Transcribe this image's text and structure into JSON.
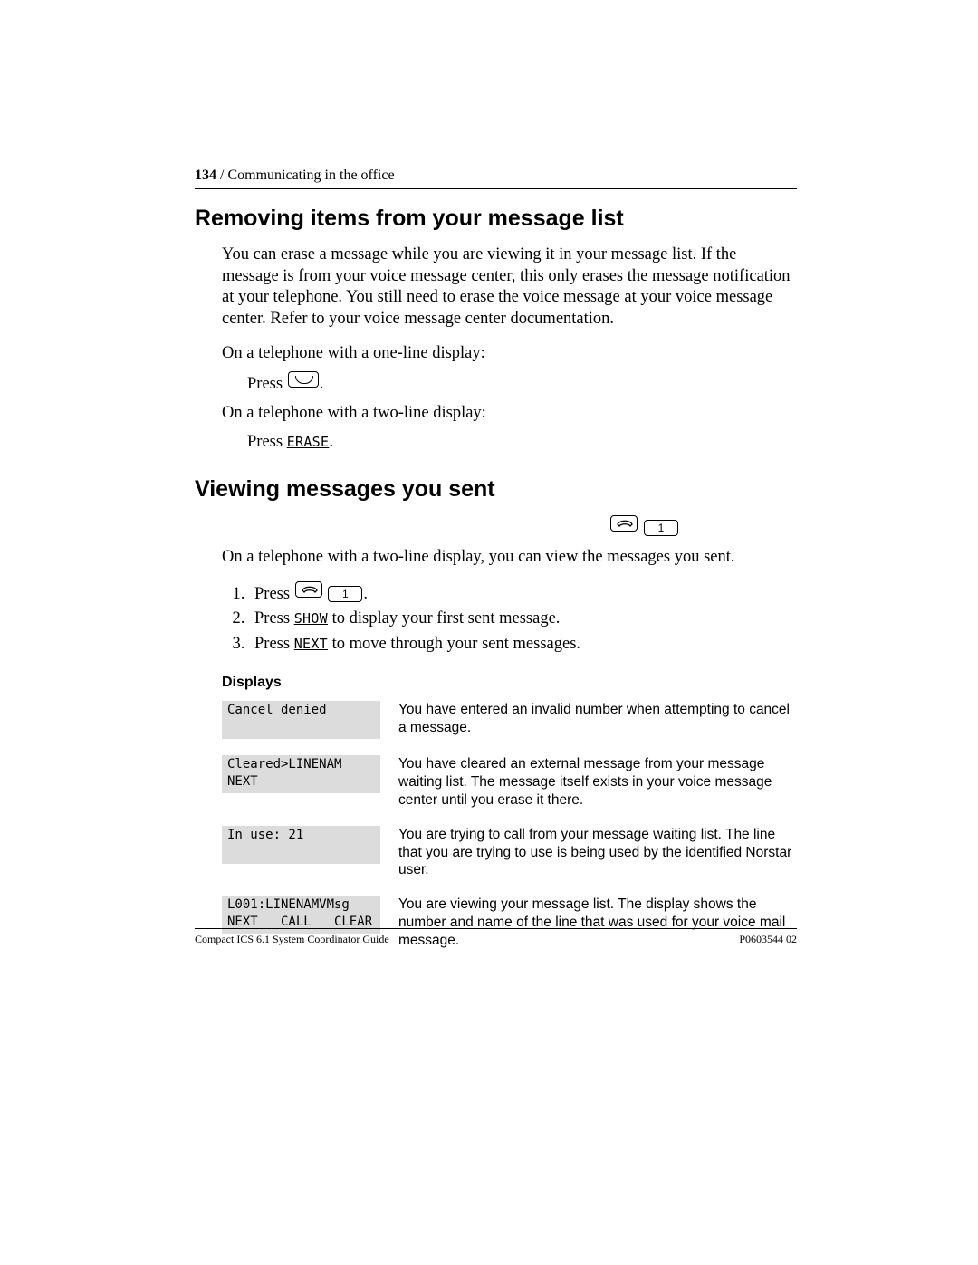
{
  "header": {
    "page_number": "134",
    "sep": " / ",
    "section": "Communicating in the office"
  },
  "section1": {
    "title": "Removing items from your message list",
    "para1": "You can erase a message while you are viewing it in your message list. If the message is from your voice message center, this only erases the message notification at your telephone. You still need to erase the voice message at your voice message center. Refer to your voice message center documentation.",
    "oneline_intro": "On a telephone with a one-line display:",
    "press_word": "Press ",
    "period": ".",
    "twoline_intro": "On a telephone with a two-line display:",
    "erase_label": "ERASE"
  },
  "section2": {
    "title": "Viewing messages you sent",
    "key_feature_icon": "feature",
    "key_digit": "1",
    "intro": "On a telephone with a two-line display, you can view the messages you sent.",
    "step1_a": "Press ",
    "step1_b": ".",
    "step2_a": "Press ",
    "step2_label": "SHOW",
    "step2_b": " to display your first sent message.",
    "step3_a": "Press ",
    "step3_label": "NEXT",
    "step3_b": " to move through your sent messages."
  },
  "displays": {
    "heading": "Displays",
    "rows": [
      {
        "line1": "Cancel denied",
        "line2": "",
        "desc": "You have entered an invalid number when attempting to cancel a message."
      },
      {
        "line1": "Cleared>LINENAM",
        "line2": "NEXT",
        "desc": "You have cleared an external message from your message waiting list. The message itself exists in your voice message center until you erase it there."
      },
      {
        "line1": "In use: 21",
        "line2": "",
        "desc": "You are trying to call from your message waiting list. The line that you are trying to use is being used by the identified Norstar user."
      },
      {
        "line1": "L001:LINENAMVMsg",
        "line2": "NEXT   CALL   CLEAR",
        "desc": "You are viewing your message list. The display shows the number and name of the line that was used for your voice mail message."
      }
    ]
  },
  "footer": {
    "left": "Compact ICS 6.1 System Coordinator Guide",
    "right": "P0603544  02"
  }
}
